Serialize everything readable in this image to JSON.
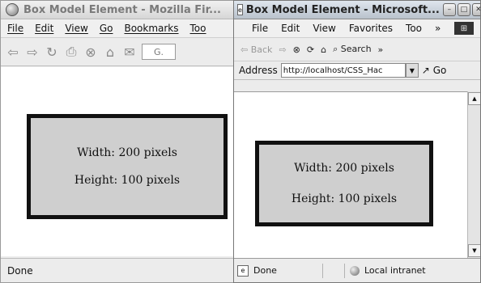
{
  "firefox": {
    "title": "Box Model Element - Mozilla Fir...",
    "menus": [
      "File",
      "Edit",
      "View",
      "Go",
      "Bookmarks",
      "Too"
    ],
    "nav_icons": [
      "back-icon",
      "forward-icon",
      "reload-icon",
      "print-icon",
      "stop-icon",
      "home-icon",
      "mail-icon"
    ],
    "url_text": "G.",
    "status": "Done",
    "box": {
      "line1": "Width: 200 pixels",
      "line2": "Height: 100 pixels"
    }
  },
  "ie": {
    "title": "Box Model Element - Microsoft...",
    "menus": [
      "File",
      "Edit",
      "View",
      "Favorites",
      "Too"
    ],
    "menu_overflow": "»",
    "toolbar": {
      "back": "Back",
      "search": "Search",
      "overflow": "»"
    },
    "address_label": "Address",
    "url": "http://localhost/CSS_Hac",
    "go": "Go",
    "status_left": "Done",
    "status_zone": "Local intranet",
    "box": {
      "line1": "Width: 200 pixels",
      "line2": "Height: 100 pixels"
    }
  }
}
